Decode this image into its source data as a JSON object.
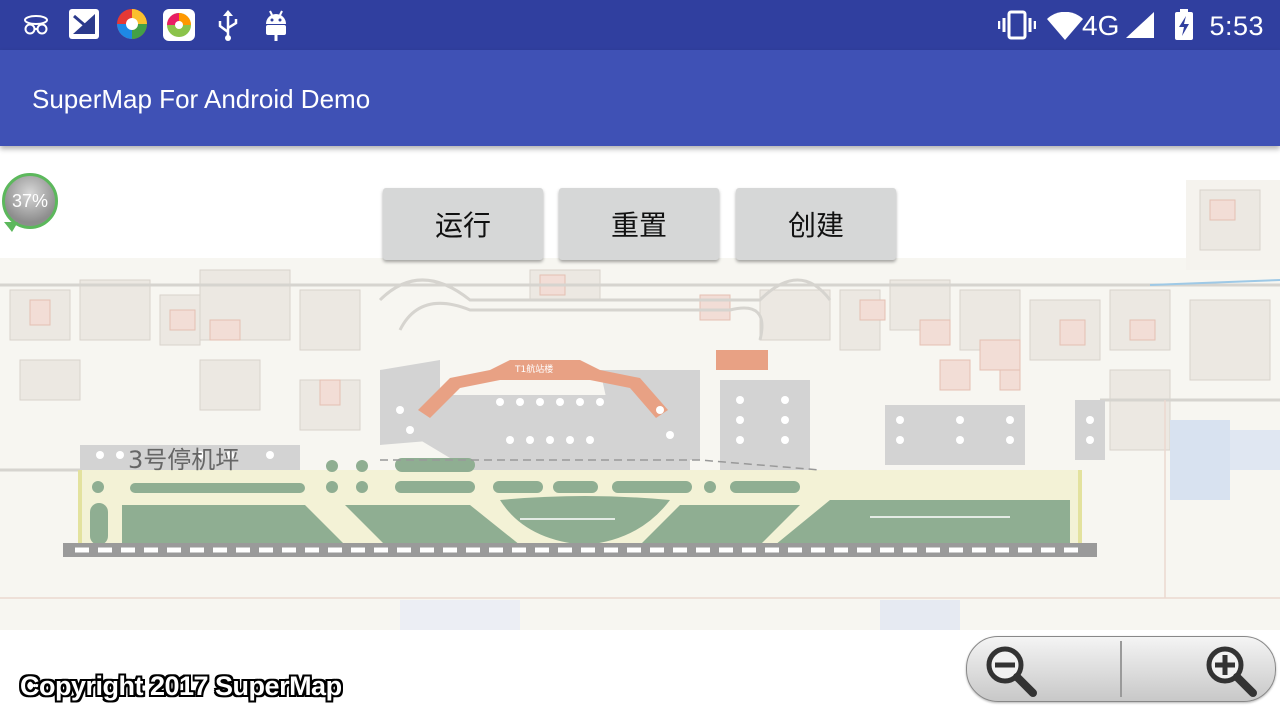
{
  "status_bar": {
    "time": "5:53",
    "network": "4G",
    "left_icons": [
      "incognito-icon",
      "app-icon",
      "colorful-app-icon",
      "app-store-icon",
      "usb-icon",
      "android-debug-icon"
    ],
    "right_icons": [
      "vibrate-icon",
      "wifi-icon",
      "signal-icon",
      "battery-charging-icon"
    ]
  },
  "app_bar": {
    "title": "SuperMap For Android Demo"
  },
  "toolbar": {
    "run_label": "运行",
    "reset_label": "重置",
    "create_label": "创建"
  },
  "loading": {
    "progress_text": "37%",
    "progress_value": 0.37
  },
  "map": {
    "label": "3号停机坪",
    "terminal_label": "T1航站楼",
    "colors": {
      "background": "#f7f6f1",
      "grass": "#8fae92",
      "terminal": "#e8a184",
      "apron": "#d3d3d3",
      "taxiway": "#f1f0c4",
      "runway": "#9a9a9a"
    }
  },
  "copyright": "Copyright 2017 SuperMap",
  "zoom": {
    "zoom_out_icon": "zoom-out-icon",
    "zoom_in_icon": "zoom-in-icon"
  }
}
